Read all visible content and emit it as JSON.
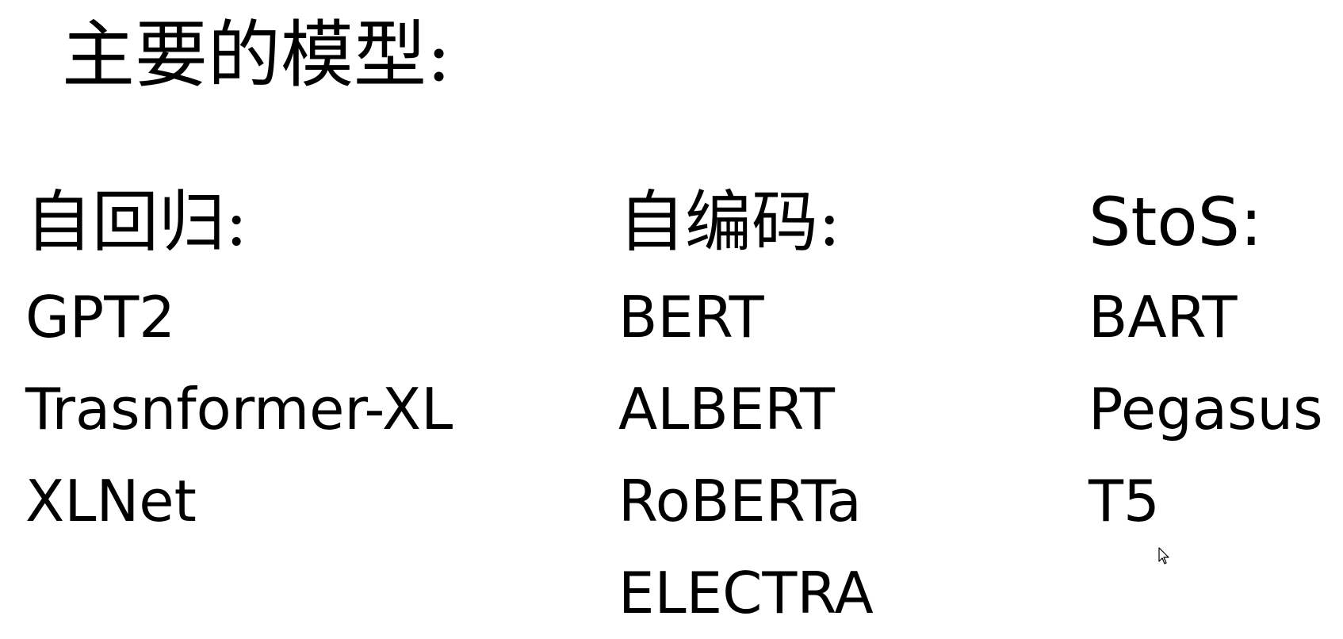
{
  "slide": {
    "title": "主要的模型:",
    "columns": [
      {
        "heading": "自回归:",
        "items": [
          "GPT2",
          "Trasnformer-XL",
          "XLNet"
        ]
      },
      {
        "heading": "自编码:",
        "items": [
          "BERT",
          "ALBERT",
          "RoBERTa",
          "ELECTRA"
        ]
      },
      {
        "heading": "StoS:",
        "items": [
          "BART",
          "Pegasus",
          "T5"
        ]
      }
    ]
  },
  "icons": {
    "cursor": "mouse-pointer-icon"
  },
  "colors": {
    "background": "#ffffff",
    "text": "#000000"
  }
}
